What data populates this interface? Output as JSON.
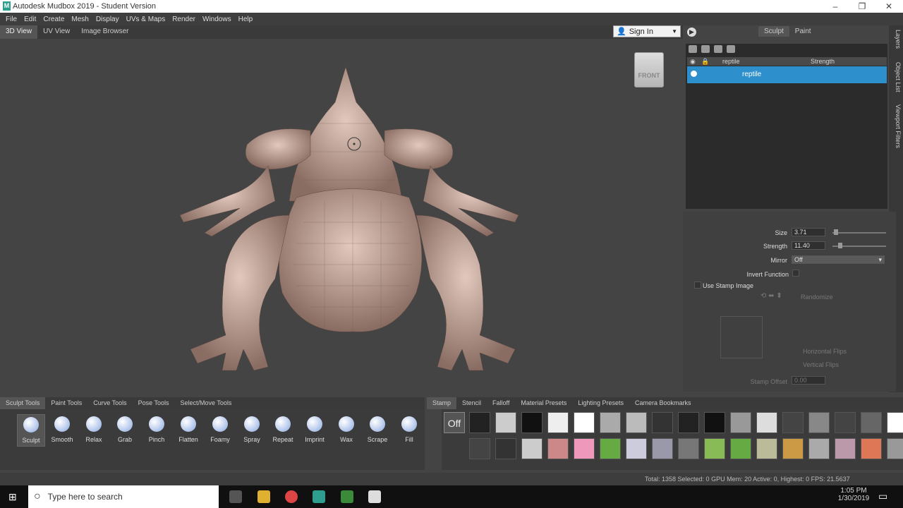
{
  "window": {
    "title": "Autodesk Mudbox 2019 - Student Version",
    "logo": "M"
  },
  "menu": [
    "File",
    "Edit",
    "Create",
    "Mesh",
    "Display",
    "UVs & Maps",
    "Render",
    "Windows",
    "Help"
  ],
  "view_tabs": [
    "3D View",
    "UV View",
    "Image Browser"
  ],
  "signin": "Sign In",
  "navcube": "FRONT",
  "right_tabs": [
    "Sculpt",
    "Paint"
  ],
  "layers": {
    "header_name": "reptile",
    "header_strength": "Strength",
    "row": "reptile"
  },
  "sidebar_tabs": [
    "Layers",
    "Object List",
    "Viewport Filters"
  ],
  "props": {
    "size_label": "Size",
    "size": "3.71",
    "size_fraction": 0.02,
    "strength_label": "Strength",
    "strength": "11.40",
    "strength_fraction": 0.11,
    "mirror_label": "Mirror",
    "mirror": "Off",
    "invert": "Invert Function",
    "stamp": "Use Stamp Image",
    "randomize": "Randomize",
    "hflip": "Horizontal Flips",
    "vflip": "Vertical Flips",
    "offset_label": "Stamp Offset",
    "offset": "0.00"
  },
  "tool_tabs": [
    "Sculpt Tools",
    "Paint Tools",
    "Curve Tools",
    "Pose Tools",
    "Select/Move Tools"
  ],
  "tools": [
    "Sculpt",
    "Smooth",
    "Relax",
    "Grab",
    "Pinch",
    "Flatten",
    "Foamy",
    "Spray",
    "Repeat",
    "Imprint",
    "Wax",
    "Scrape",
    "Fill"
  ],
  "tray_tabs": [
    "Stamp",
    "Stencil",
    "Falloff",
    "Material Presets",
    "Lighting Presets",
    "Camera Bookmarks"
  ],
  "stamp_off": "Off",
  "status": "Total: 1358  Selected: 0 GPU Mem: 20  Active: 0, Highest: 0  FPS: 21.5637",
  "taskbar": {
    "search": "Type here to search",
    "time": "1:05 PM",
    "date": "1/30/2019"
  }
}
